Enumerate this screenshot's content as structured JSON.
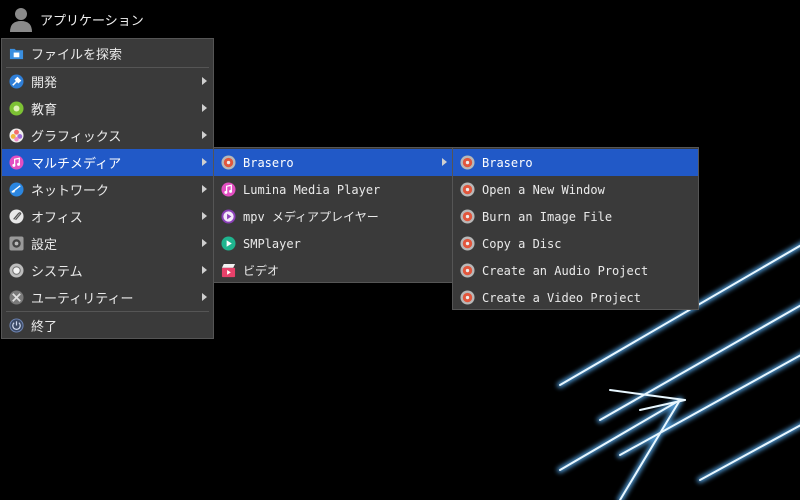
{
  "topbar": {
    "title": "アプリケーション",
    "icon": "user-icon"
  },
  "main_menu": {
    "items": [
      {
        "label": "ファイルを探索",
        "icon": "file-manager-icon",
        "submenu": false
      },
      {
        "label": "開発",
        "icon": "development-icon",
        "submenu": true
      },
      {
        "label": "教育",
        "icon": "education-icon",
        "submenu": true
      },
      {
        "label": "グラフィックス",
        "icon": "graphics-icon",
        "submenu": true
      },
      {
        "label": "マルチメディア",
        "icon": "multimedia-icon",
        "submenu": true,
        "selected": true
      },
      {
        "label": "ネットワーク",
        "icon": "network-icon",
        "submenu": true
      },
      {
        "label": "オフィス",
        "icon": "office-icon",
        "submenu": true
      },
      {
        "label": "設定",
        "icon": "settings-icon",
        "submenu": true
      },
      {
        "label": "システム",
        "icon": "system-icon",
        "submenu": true
      },
      {
        "label": "ユーティリティー",
        "icon": "utilities-icon",
        "submenu": true
      },
      {
        "label": "終了",
        "icon": "logout-icon",
        "submenu": false
      }
    ]
  },
  "multimedia_menu": {
    "items": [
      {
        "label": "Brasero",
        "icon": "brasero-icon",
        "submenu": true,
        "selected": true
      },
      {
        "label": "Lumina Media Player",
        "icon": "media-player-icon",
        "submenu": false
      },
      {
        "label": "mpv メディアプレイヤー",
        "icon": "mpv-icon",
        "submenu": false
      },
      {
        "label": "SMPlayer",
        "icon": "smplayer-icon",
        "submenu": false
      },
      {
        "label": "ビデオ",
        "icon": "video-icon",
        "submenu": false
      }
    ]
  },
  "brasero_menu": {
    "items": [
      {
        "label": "Brasero",
        "icon": "brasero-icon",
        "selected": true
      },
      {
        "label": "Open a New Window",
        "icon": "brasero-icon"
      },
      {
        "label": "Burn an Image File",
        "icon": "brasero-icon"
      },
      {
        "label": "Copy a Disc",
        "icon": "brasero-icon"
      },
      {
        "label": "Create an Audio Project",
        "icon": "brasero-icon"
      },
      {
        "label": "Create a Video Project",
        "icon": "brasero-icon"
      }
    ]
  },
  "colors": {
    "selection": "#2159c7",
    "menu_bg": "#3a3a3a",
    "wallpaper_glow": "#7fd0ff"
  }
}
